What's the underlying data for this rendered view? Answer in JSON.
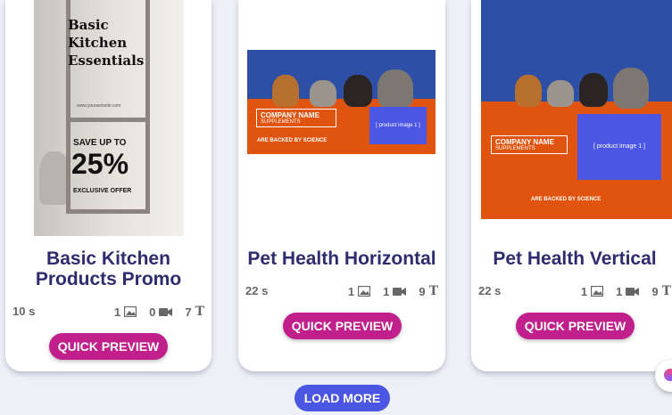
{
  "cards": [
    {
      "title": "Basic Kitchen Products Promo",
      "duration": "10 s",
      "images": "1",
      "videos": "0",
      "texts": "7",
      "button": "QUICK PREVIEW",
      "thumb": {
        "headline": "Basic Kitchen Essentials",
        "url": "www.yourwebsite.com",
        "save": "SAVE UP TO",
        "percent": "25%",
        "offer": "EXCLUSIVE OFFER"
      }
    },
    {
      "title": "Pet Health Horizontal",
      "duration": "22 s",
      "images": "1",
      "videos": "1",
      "texts": "9",
      "button": "QUICK PREVIEW",
      "thumb": {
        "company": "COMPANY NAME",
        "supplements": "SUPPLEMENTS",
        "slot": "[ product image 1 ]",
        "tagline": "ARE BACKED BY SCIENCE"
      }
    },
    {
      "title": "Pet Health Vertical",
      "duration": "22 s",
      "images": "1",
      "videos": "1",
      "texts": "9",
      "button": "QUICK PREVIEW",
      "thumb": {
        "company": "COMPANY NAME",
        "supplements": "SUPPLEMENTS",
        "slot": "[ product image 1 ]",
        "tagline": "ARE BACKED BY SCIENCE"
      }
    }
  ],
  "load_more": "LOAD MORE",
  "icons": {
    "image": "image-icon",
    "video": "video-camera-icon",
    "text": "text-T-icon",
    "chat": "chat-launcher-icon"
  },
  "colors": {
    "title": "#2e2c6e",
    "quick_preview": "#c1208c",
    "load_more": "#4b56e3",
    "banner_blue": "#2d4fa6",
    "banner_orange": "#e05410"
  }
}
